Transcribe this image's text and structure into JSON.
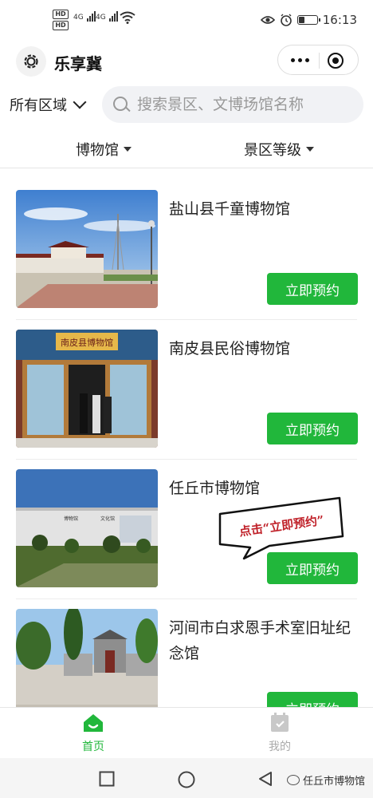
{
  "status_bar": {
    "hd1": "HD",
    "hd2": "HD",
    "net1": "4G",
    "net2": "4G",
    "time": "16:13",
    "battery_level": 0.35
  },
  "header": {
    "title": "乐享冀"
  },
  "search": {
    "region_label": "所有区域",
    "placeholder": "搜索景区、文博场馆名称"
  },
  "filters": {
    "category": "博物馆",
    "level": "景区等级"
  },
  "venues": [
    {
      "name": "盐山县千童博物馆",
      "button": "立即预约"
    },
    {
      "name": "南皮县民俗博物馆",
      "button": "立即预约"
    },
    {
      "name": "任丘市博物馆",
      "button": "立即预约"
    },
    {
      "name": "河间市白求恩手术室旧址纪念馆",
      "button": "立即预约"
    }
  ],
  "photo_signs": {
    "nanpi": "南皮县博物馆",
    "renqiu_left": "博物馆",
    "renqiu_right": "文化馆"
  },
  "callout": {
    "text": "点击“立即预约”"
  },
  "tabbar": {
    "home": "首页",
    "mine": "我的",
    "active_color": "#21b73b"
  },
  "watermark": {
    "text": "任丘市博物馆"
  }
}
